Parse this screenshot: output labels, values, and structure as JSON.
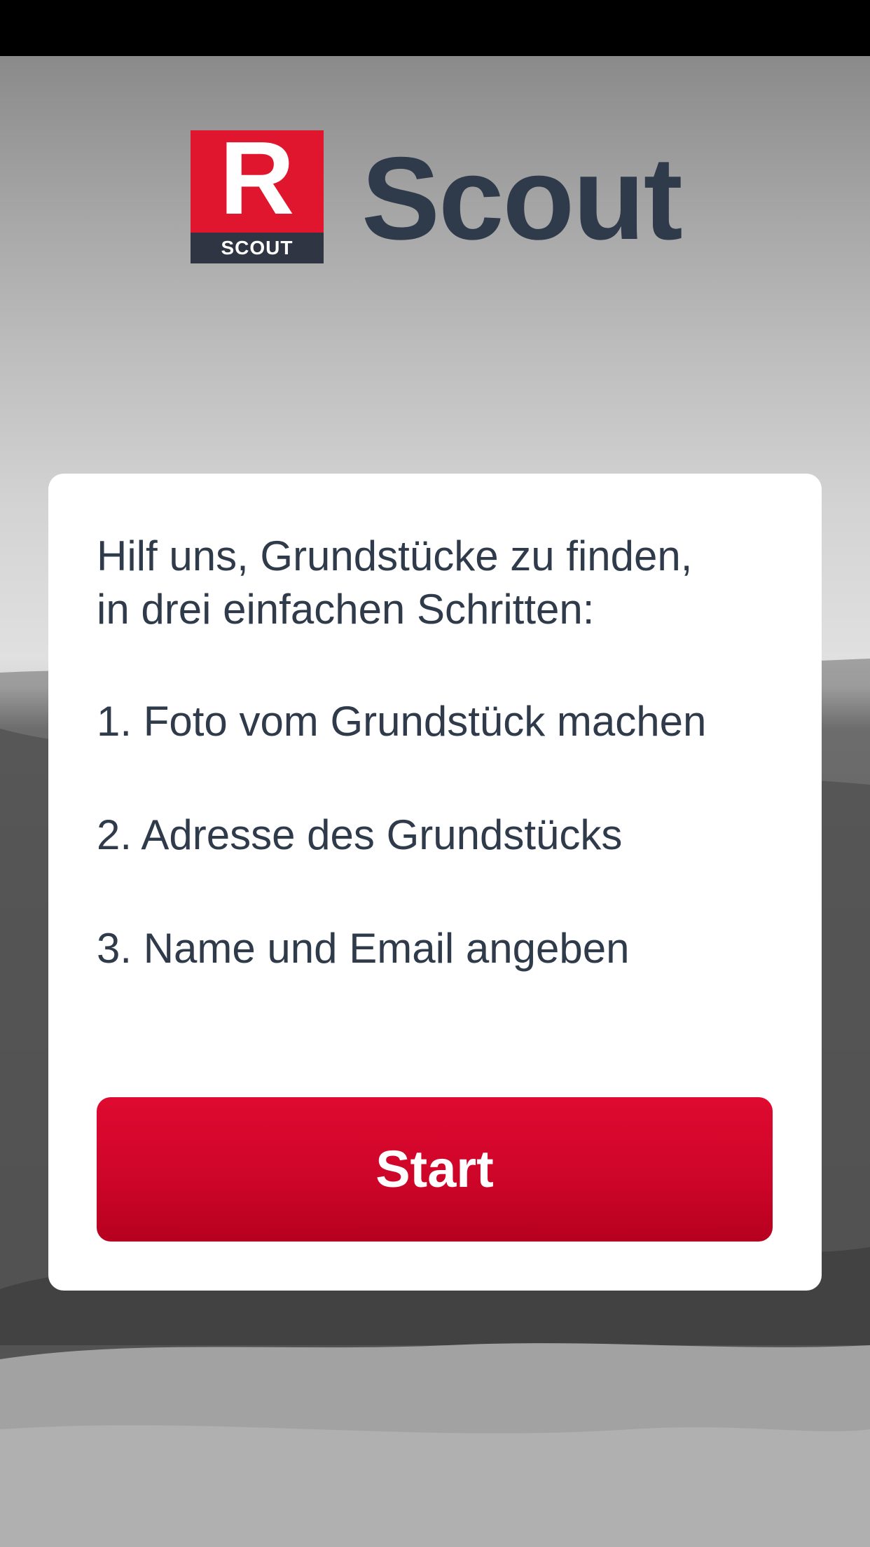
{
  "status_bar": {},
  "logo": {
    "letter": "R",
    "badge": "SCOUT"
  },
  "app_title": "Scout",
  "card": {
    "intro_line1": "Hilf uns, Grundstücke zu finden,",
    "intro_line2": "in drei einfachen Schritten:",
    "steps": [
      "1. Foto vom Grundstück machen",
      "2. Adresse des Grundstücks",
      "3. Name und Email angeben"
    ],
    "start_label": "Start"
  },
  "colors": {
    "brand_red": "#e0162e",
    "button_red": "#cc0528",
    "text_dark": "#2f3b4a",
    "logo_dark": "#2f3542"
  }
}
